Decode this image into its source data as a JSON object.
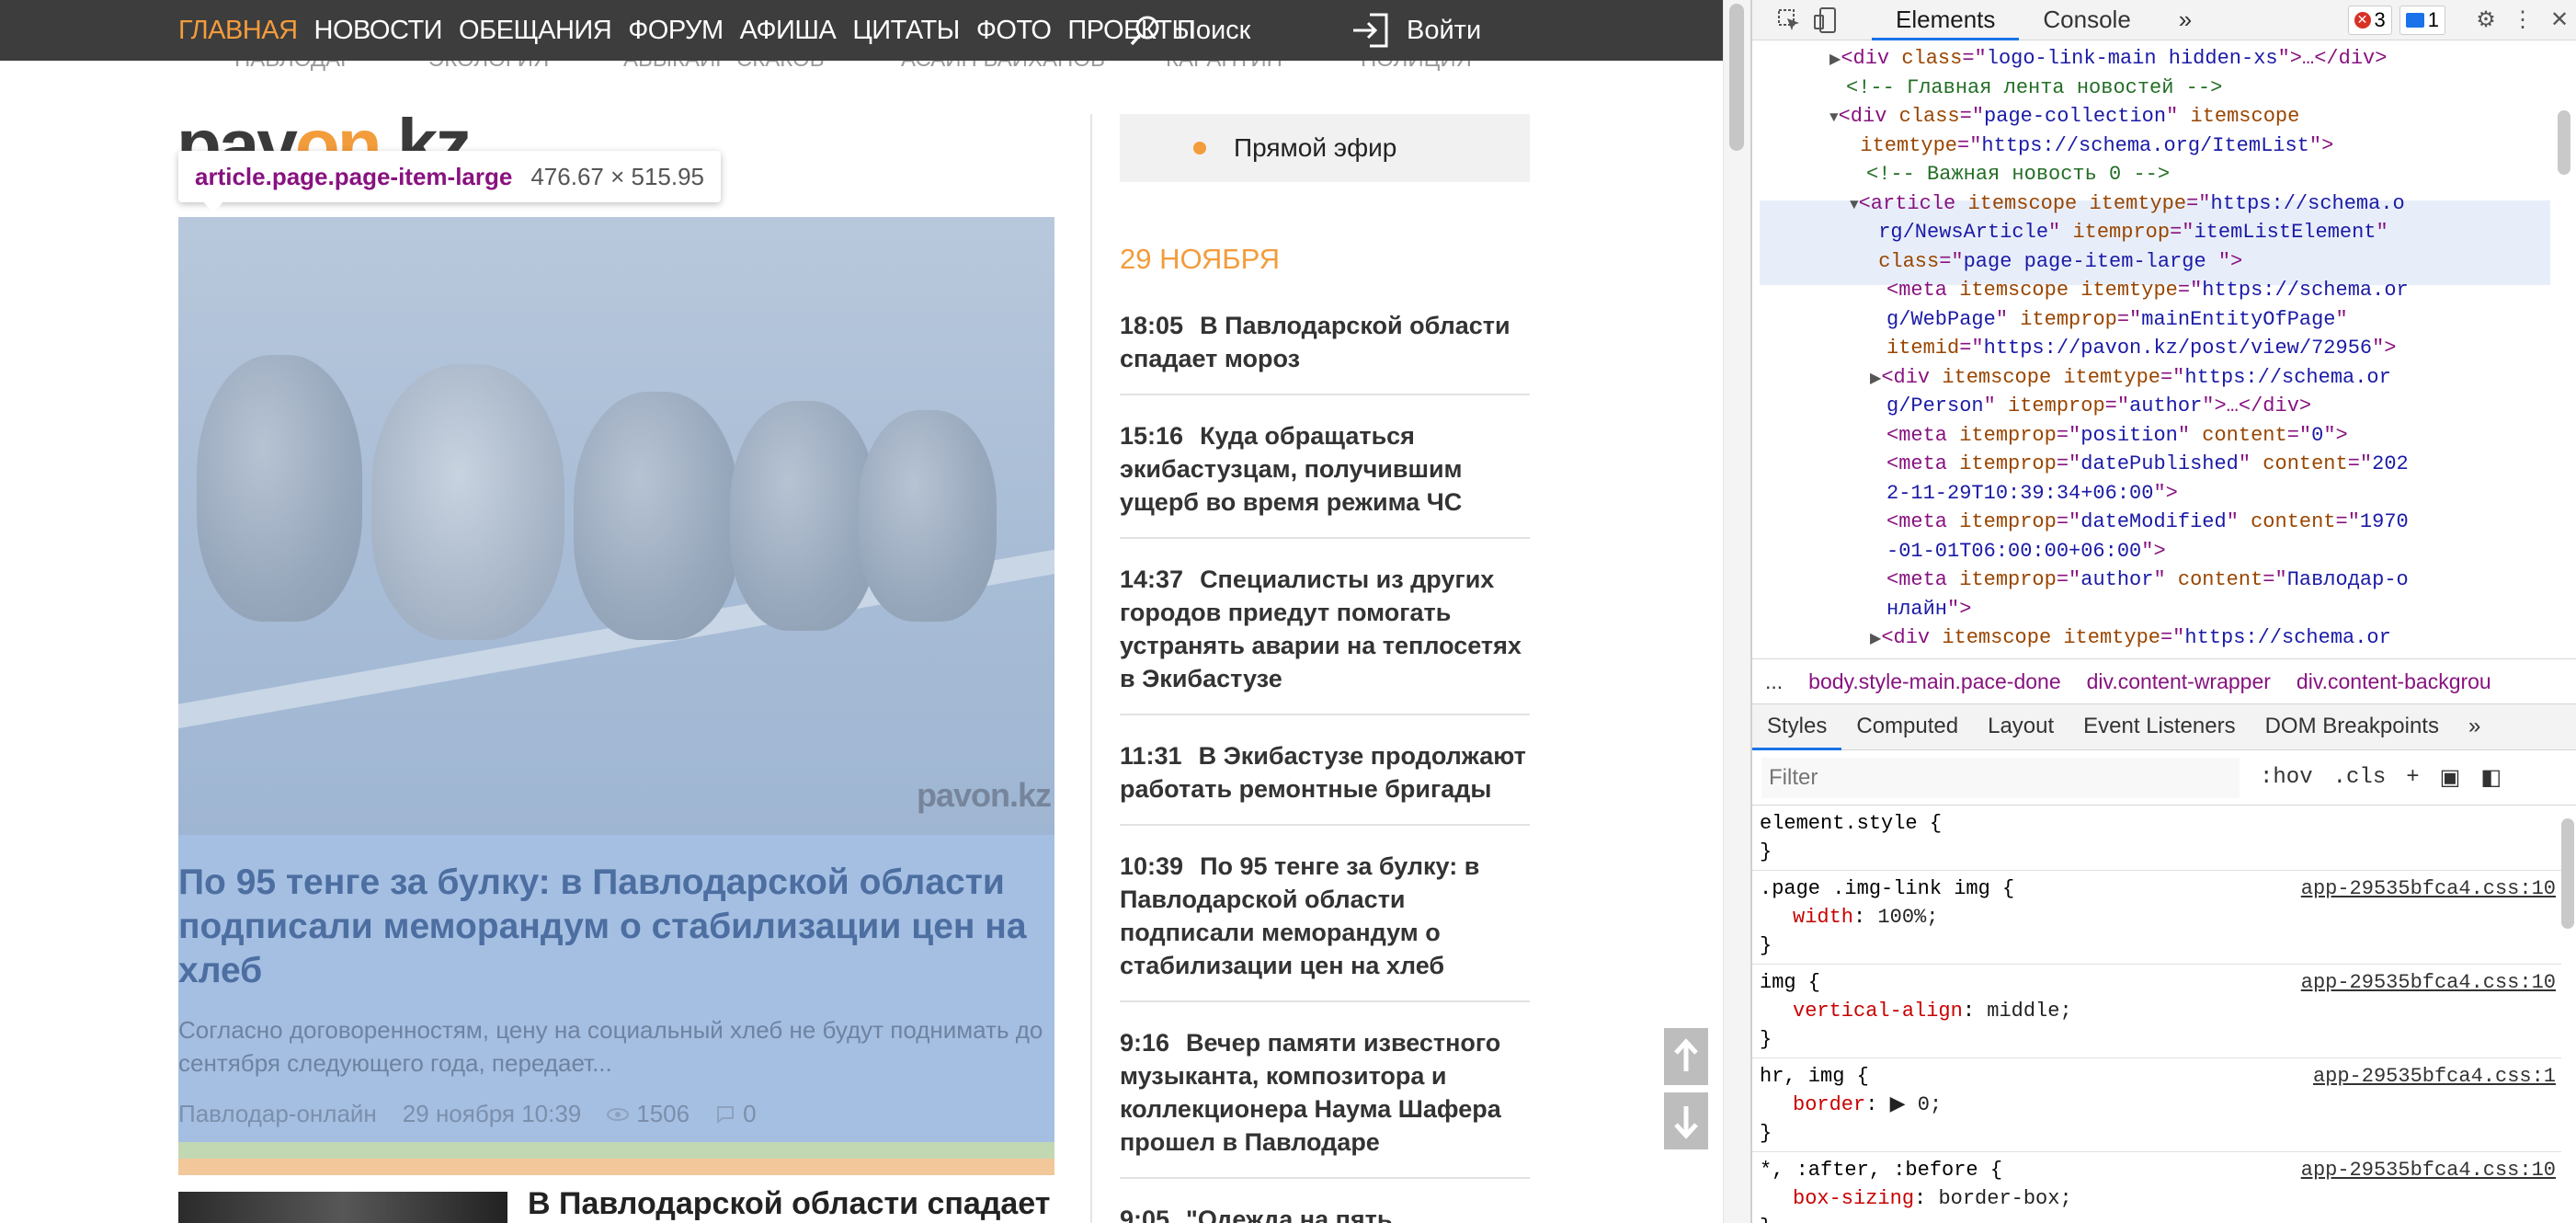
{
  "site": {
    "nav": {
      "items": [
        "ГЛАВНАЯ",
        "НОВОСТИ",
        "ОБЕЩАНИЯ",
        "ФОРУМ",
        "АФИША",
        "ЦИТАТЫ",
        "ФОТО",
        "ПРОЕКТЫ"
      ],
      "search_label": "Поиск",
      "login_label": "Войти",
      "accent_color": "#f39c3c"
    },
    "tags": [
      "ПАВЛОДАР",
      "ЭКОЛОГИЯ",
      "АБЫКАИР СКАКОВ",
      "АСАИН БАЙХАНОВ",
      "КАРАНТИН",
      "ПОЛИЦИЯ"
    ],
    "logo": {
      "part1": "pav",
      "part2": "on",
      "part3": ".kz"
    },
    "inspect_tooltip": {
      "selector": "article.page.page-item-large",
      "size": "476.67 × 515.95"
    },
    "big_article": {
      "watermark": "pavon.kz",
      "title": "По 95 тенге за булку: в Павлодарской области подписали меморандум о стабилизации цен на хлеб",
      "lead": "Согласно договоренностям, цену на социальный хлеб не будут поднимать до сентября следующего года, передает...",
      "author": "Павлодар-онлайн",
      "date": "29 ноября 10:39",
      "views": "1506",
      "comments": "0"
    },
    "second_article": {
      "title": "В Павлодарской области спадает"
    },
    "live": {
      "label": "Прямой эфир"
    },
    "date_header": "29 НОЯБРЯ",
    "news": [
      {
        "time": "18:05",
        "title": "В Павлодарской области спадает мороз"
      },
      {
        "time": "15:16",
        "title": "Куда обращаться экибастузцам, получившим ущерб во время режима ЧС"
      },
      {
        "time": "14:37",
        "title": "Специалисты из других городов приедут помогать устранять аварии на теплосетях в Экибастузе"
      },
      {
        "time": "11:31",
        "title": "В Экибастузе продолжают работать ремонтные бригады"
      },
      {
        "time": "10:39",
        "title": "По 95 тенге за булку: в Павлодарской области подписали меморандум о стабилизации цен на хлеб"
      },
      {
        "time": "9:16",
        "title": "Вечер памяти известного музыканта, композитора и коллекционера Наума Шафера прошел в Павлодаре"
      },
      {
        "time": "9:05",
        "title": "\"Одежда на пять"
      }
    ]
  },
  "devtools": {
    "tabs": [
      "Elements",
      "Console"
    ],
    "errors": "3",
    "messages": "1",
    "dom_lines": [
      {
        "indent": 1,
        "tri": "▶",
        "parts": [
          [
            "t",
            "<div "
          ],
          [
            "a",
            "class"
          ],
          [
            "t",
            "=\""
          ],
          [
            "v",
            "logo-link-main hidden-xs"
          ],
          [
            "t",
            "\">…</div>"
          ]
        ]
      },
      {
        "indent": 1,
        "tri": "",
        "parts": [
          [
            "c",
            "<!-- Главная лента новостей -->"
          ]
        ]
      },
      {
        "indent": 1,
        "tri": "▼",
        "parts": [
          [
            "t",
            "<div "
          ],
          [
            "a",
            "class"
          ],
          [
            "t",
            "=\""
          ],
          [
            "v",
            "page-collection"
          ],
          [
            "t",
            "\" "
          ],
          [
            "a",
            "itemscope"
          ]
        ]
      },
      {
        "indent": 1.7,
        "tri": "",
        "parts": [
          [
            "a",
            "itemtype"
          ],
          [
            "t",
            "=\""
          ],
          [
            "v",
            "https://schema.org/ItemList"
          ],
          [
            "t",
            "\">"
          ]
        ]
      },
      {
        "indent": 2,
        "tri": "",
        "parts": [
          [
            "c",
            "<!-- Важная новость 0 -->"
          ]
        ]
      },
      {
        "indent": 2,
        "tri": "▼",
        "parts": [
          [
            "t",
            "<article "
          ],
          [
            "a",
            "itemscope"
          ],
          [
            "t",
            " "
          ],
          [
            "a",
            "itemtype"
          ],
          [
            "t",
            "=\""
          ],
          [
            "v",
            "https://schema.o"
          ]
        ]
      },
      {
        "indent": 2.6,
        "tri": "",
        "parts": [
          [
            "v",
            "rg/NewsArticle"
          ],
          [
            "t",
            "\" "
          ],
          [
            "a",
            "itemprop"
          ],
          [
            "t",
            "=\""
          ],
          [
            "v",
            "itemListElement"
          ],
          [
            "t",
            "\""
          ]
        ]
      },
      {
        "indent": 2.6,
        "tri": "",
        "parts": [
          [
            "a",
            "class"
          ],
          [
            "t",
            "=\""
          ],
          [
            "v",
            "page page-item-large  "
          ],
          [
            "t",
            "\">"
          ]
        ]
      },
      {
        "indent": 3,
        "tri": "",
        "parts": [
          [
            "t",
            "<meta "
          ],
          [
            "a",
            "itemscope"
          ],
          [
            "t",
            " "
          ],
          [
            "a",
            "itemtype"
          ],
          [
            "t",
            "=\""
          ],
          [
            "v",
            "https://schema.or"
          ]
        ]
      },
      {
        "indent": 3,
        "tri": "",
        "parts": [
          [
            "v",
            "g/WebPage"
          ],
          [
            "t",
            "\" "
          ],
          [
            "a",
            "itemprop"
          ],
          [
            "t",
            "=\""
          ],
          [
            "v",
            "mainEntityOfPage"
          ],
          [
            "t",
            "\""
          ]
        ]
      },
      {
        "indent": 3,
        "tri": "",
        "parts": [
          [
            "a",
            "itemid"
          ],
          [
            "t",
            "=\""
          ],
          [
            "v",
            "https://pavon.kz/post/view/72956"
          ],
          [
            "t",
            "\">"
          ]
        ]
      },
      {
        "indent": 3,
        "tri": "▶",
        "parts": [
          [
            "t",
            "<div "
          ],
          [
            "a",
            "itemscope"
          ],
          [
            "t",
            " "
          ],
          [
            "a",
            "itemtype"
          ],
          [
            "t",
            "=\""
          ],
          [
            "v",
            "https://schema.or"
          ]
        ]
      },
      {
        "indent": 3,
        "tri": "",
        "parts": [
          [
            "v",
            "g/Person"
          ],
          [
            "t",
            "\" "
          ],
          [
            "a",
            "itemprop"
          ],
          [
            "t",
            "=\""
          ],
          [
            "v",
            "author"
          ],
          [
            "t",
            "\">…</div>"
          ]
        ]
      },
      {
        "indent": 3,
        "tri": "",
        "parts": [
          [
            "t",
            "<meta "
          ],
          [
            "a",
            "itemprop"
          ],
          [
            "t",
            "=\""
          ],
          [
            "v",
            "position"
          ],
          [
            "t",
            "\" "
          ],
          [
            "a",
            "content"
          ],
          [
            "t",
            "=\""
          ],
          [
            "v",
            "0"
          ],
          [
            "t",
            "\">"
          ]
        ]
      },
      {
        "indent": 3,
        "tri": "",
        "parts": [
          [
            "t",
            "<meta "
          ],
          [
            "a",
            "itemprop"
          ],
          [
            "t",
            "=\""
          ],
          [
            "v",
            "datePublished"
          ],
          [
            "t",
            "\" "
          ],
          [
            "a",
            "content"
          ],
          [
            "t",
            "=\""
          ],
          [
            "v",
            "202"
          ]
        ]
      },
      {
        "indent": 3,
        "tri": "",
        "parts": [
          [
            "v",
            "2-11-29T10:39:34+06:00"
          ],
          [
            "t",
            "\">"
          ]
        ]
      },
      {
        "indent": 3,
        "tri": "",
        "parts": [
          [
            "t",
            "<meta "
          ],
          [
            "a",
            "itemprop"
          ],
          [
            "t",
            "=\""
          ],
          [
            "v",
            "dateModified"
          ],
          [
            "t",
            "\" "
          ],
          [
            "a",
            "content"
          ],
          [
            "t",
            "=\""
          ],
          [
            "v",
            "1970"
          ]
        ]
      },
      {
        "indent": 3,
        "tri": "",
        "parts": [
          [
            "v",
            "-01-01T06:00:00+06:00"
          ],
          [
            "t",
            "\">"
          ]
        ]
      },
      {
        "indent": 3,
        "tri": "",
        "parts": [
          [
            "t",
            "<meta "
          ],
          [
            "a",
            "itemprop"
          ],
          [
            "t",
            "=\""
          ],
          [
            "v",
            "author"
          ],
          [
            "t",
            "\" "
          ],
          [
            "a",
            "content"
          ],
          [
            "t",
            "=\""
          ],
          [
            "v",
            "Павлодар-о"
          ]
        ]
      },
      {
        "indent": 3,
        "tri": "",
        "parts": [
          [
            "v",
            "нлайн"
          ],
          [
            "t",
            "\">"
          ]
        ]
      },
      {
        "indent": 3,
        "tri": "▶",
        "parts": [
          [
            "t",
            "<div "
          ],
          [
            "a",
            "itemscope"
          ],
          [
            "t",
            " "
          ],
          [
            "a",
            "itemtype"
          ],
          [
            "t",
            "=\""
          ],
          [
            "v",
            "https://schema.or"
          ]
        ]
      }
    ],
    "breadcrumbs": [
      "...",
      "body.style-main.pace-done",
      "div.content-wrapper",
      "div.content-backgrou"
    ],
    "styles_tabs": [
      "Styles",
      "Computed",
      "Layout",
      "Event Listeners",
      "DOM Breakpoints"
    ],
    "filter_placeholder": "Filter",
    "filter_buttons": [
      ":hov",
      ".cls",
      "+"
    ],
    "rules": [
      {
        "selector": "element.style {",
        "source": "",
        "props": []
      },
      {
        "selector": ".page .img-link img {",
        "source": "app-29535bfca4.css:10",
        "props": [
          [
            "width",
            "100%;"
          ]
        ]
      },
      {
        "selector": "img {",
        "source": "app-29535bfca4.css:10",
        "props": [
          [
            "vertical-align",
            "middle;"
          ]
        ]
      },
      {
        "selector": "hr, img {",
        "source": "app-29535bfca4.css:1",
        "props": [
          [
            "border",
            "▶ 0;"
          ]
        ]
      },
      {
        "selector": "*, :after, :before {",
        "source": "app-29535bfca4.css:10",
        "props": [
          [
            "box-sizing",
            "border-box;"
          ]
        ]
      }
    ]
  }
}
